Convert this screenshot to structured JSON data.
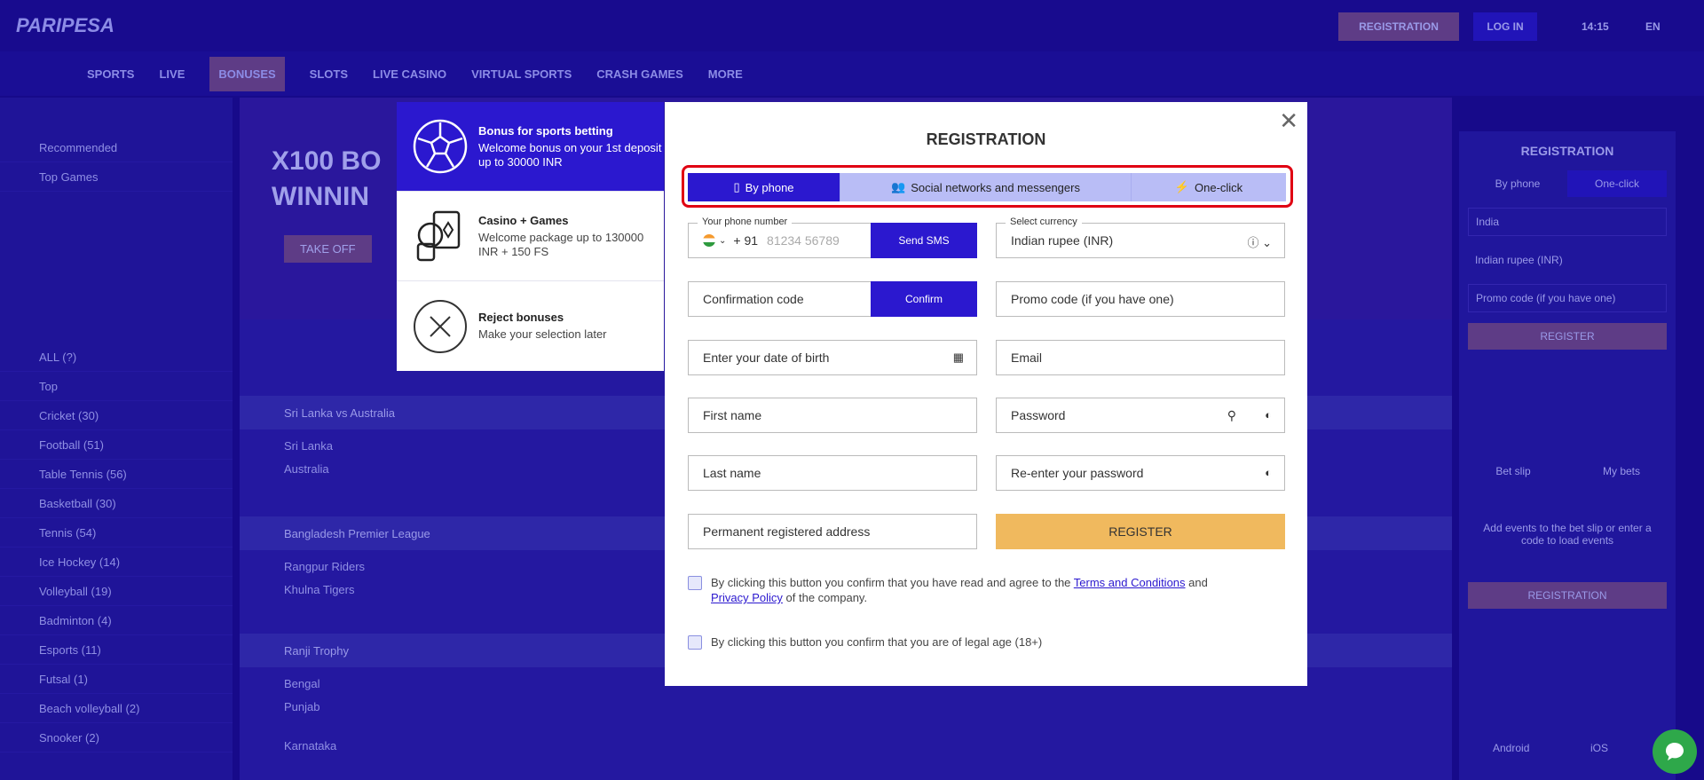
{
  "background": {
    "logo": "PARIPESA",
    "header_buttons": {
      "registration": "REGISTRATION",
      "login": "LOG IN",
      "time": "14:15",
      "lang": "EN"
    },
    "nav": [
      "SPORTS",
      "LIVE",
      "BONUSES",
      "SLOTS",
      "LIVE CASINO",
      "VIRTUAL SPORTS",
      "CRASH GAMES",
      "MORE"
    ],
    "sidebar": [
      "Recommended",
      "Top Games",
      "ALL (?)",
      "Top",
      "Cricket (30)",
      "Football (51)",
      "Table Tennis (56)",
      "Basketball (30)",
      "Tennis (54)",
      "Ice Hockey (14)",
      "Volleyball (19)",
      "Badminton (4)",
      "Esports (11)",
      "Futsal (1)",
      "Beach volleyball (2)",
      "Snooker (2)"
    ],
    "banner": {
      "title": "X100 BO\nWINNIN",
      "button": "TAKE OFF"
    },
    "events": [
      {
        "league": "Sri Lanka vs Australia",
        "teams": [
          "Sri Lanka",
          "Australia"
        ]
      },
      {
        "league": "Bangladesh Premier League",
        "teams": [
          "Rangpur Riders",
          "Khulna Tigers"
        ]
      },
      {
        "league": "Ranji Trophy",
        "teams": [
          "Bengal",
          "Punjab",
          "Karnataka"
        ]
      }
    ],
    "right_panel": {
      "title": "REGISTRATION",
      "by_phone": "By phone",
      "one_click": "One-click",
      "country": "India",
      "currency": "Indian rupee (INR)",
      "promo": "Promo code (if you have one)",
      "register": "REGISTER",
      "bet_slip": "Bet slip",
      "my_bets": "My bets",
      "empty": "Add events to the bet slip or enter a code to load events",
      "registration": "REGISTRATION",
      "android": "Android",
      "ios": "iOS"
    }
  },
  "bonuses": [
    {
      "title": "Bonus for sports betting",
      "desc": "Welcome bonus on your 1st deposit up to 30000 INR",
      "icon": "soccer-ball-icon",
      "active": true
    },
    {
      "title": "Casino + Games",
      "desc": "Welcome package up to 130000 INR + 150 FS",
      "icon": "casino-cards-icon",
      "active": false
    },
    {
      "title": "Reject bonuses",
      "desc": "Make your selection later",
      "icon": "reject-x-icon",
      "active": false
    }
  ],
  "modal": {
    "title": "REGISTRATION",
    "tabs": [
      {
        "label": "By phone",
        "icon": "phone-icon",
        "active": true
      },
      {
        "label": "Social networks and messengers",
        "icon": "users-icon"
      },
      {
        "label": "One-click",
        "icon": "lightning-icon"
      }
    ],
    "phone": {
      "legend": "Your phone number",
      "code": "+ 91",
      "placeholder": "81234 56789",
      "send": "Send SMS"
    },
    "currency": {
      "legend": "Select currency",
      "value": "Indian rupee (INR)"
    },
    "confirmation": {
      "placeholder": "Confirmation code",
      "button": "Confirm"
    },
    "promo": "Promo code (if you have one)",
    "dob": "Enter your date of birth",
    "email": "Email",
    "first_name": "First name",
    "password": "Password",
    "last_name": "Last name",
    "repassword": "Re-enter your password",
    "address": "Permanent registered address",
    "register": "REGISTER",
    "terms": {
      "pre": "By clicking this button you confirm that you have read and agree to the ",
      "terms_link": "Terms and Conditions",
      "mid": " and ",
      "privacy_link": "Privacy Policy",
      "post": " of the company."
    },
    "age": "By clicking this button you confirm that you are of legal age (18+)"
  },
  "colors": {
    "accent": "#2b18cf",
    "register": "#f0b95e",
    "highlight": "#e00012",
    "chat": "#2ea84a"
  }
}
